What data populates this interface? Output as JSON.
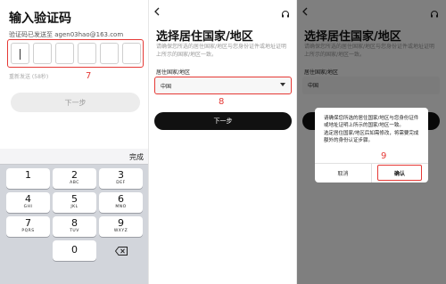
{
  "step1": {
    "title": "输入验证码",
    "subtitle": "验证码已发送至 agen03hao@163.com",
    "resend": "重新发送 (58秒)",
    "annotation": "7",
    "next_label": "下一步"
  },
  "keyboard": {
    "done_label": "完成",
    "keys": [
      {
        "n": "1",
        "l": ""
      },
      {
        "n": "2",
        "l": "ABC"
      },
      {
        "n": "3",
        "l": "DEF"
      },
      {
        "n": "4",
        "l": "GHI"
      },
      {
        "n": "5",
        "l": "JKL"
      },
      {
        "n": "6",
        "l": "MNO"
      },
      {
        "n": "7",
        "l": "PQRS"
      },
      {
        "n": "8",
        "l": "TUV"
      },
      {
        "n": "9",
        "l": "WXYZ"
      },
      {
        "n": "0",
        "l": ""
      }
    ]
  },
  "step2": {
    "title": "选择居住国家/地区",
    "description": "请确保您所选的居住国家/地区与您身份证件或地址证明上所示的国家/地区一致。",
    "field_label": "居住国家/地区",
    "selected_country": "中国",
    "annotation": "8",
    "next_label": "下一步"
  },
  "step3": {
    "title": "选择居住国家/地区",
    "description": "请确保您所选的居住国家/地区与您身份证件或地址证明上所示的国家/地区一致。",
    "field_label": "居住国家/地区",
    "selected_country": "中国",
    "dialog": {
      "line1": "请确保您所选的居住国家/地区与您身份证件或地址证明上所示的国家/地区一致。",
      "line2": "选定居住国家/地区后如需修改，将需要完成额外的身份认证步骤。",
      "cancel_label": "取消",
      "confirm_label": "确认",
      "annotation": "9"
    }
  },
  "colors": {
    "highlight": "#e53935",
    "primary_button": "#111111"
  }
}
